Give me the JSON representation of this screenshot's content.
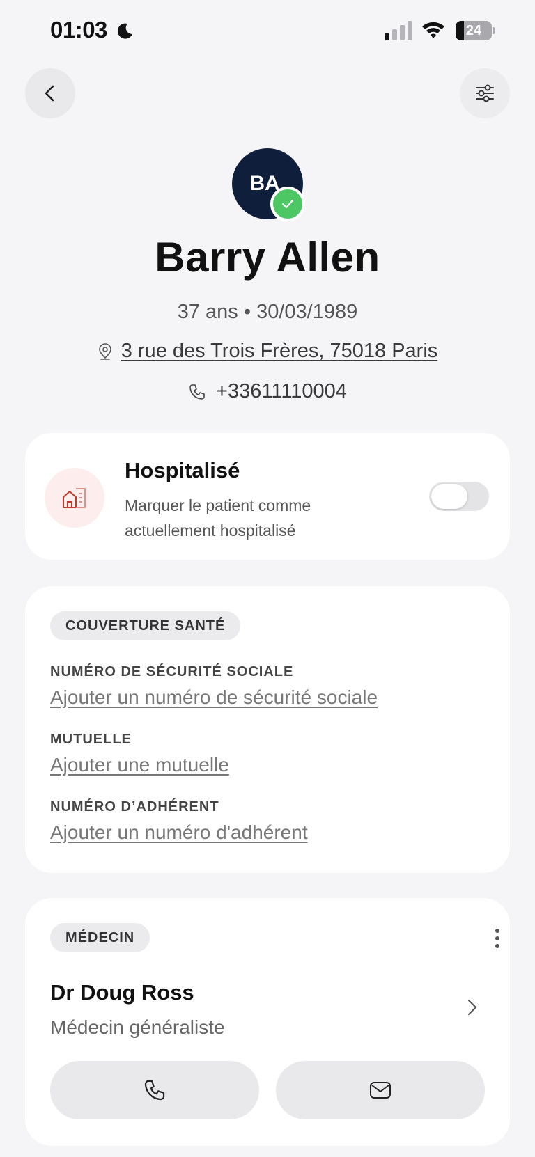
{
  "status_bar": {
    "time": "01:03",
    "battery_level": "24",
    "battery_fraction": 0.24,
    "icons": [
      "moon-icon",
      "cellular-signal-icon",
      "wifi-icon",
      "battery-icon"
    ]
  },
  "nav": {
    "back_icon": "chevron-left-icon",
    "filter_icon": "sliders-icon"
  },
  "patient": {
    "initials": "BA",
    "name": "Barry Allen",
    "age": "37 ans",
    "separator": "•",
    "birthdate": "30/03/1989",
    "address": "3 rue des Trois Frères, 75018 Paris",
    "phone": "+33611110004"
  },
  "hospitalized": {
    "title": "Hospitalisé",
    "description": "Marquer le patient comme actuellement hospitalisé",
    "enabled": false
  },
  "coverage": {
    "badge": "COUVERTURE SANTÉ",
    "fields": [
      {
        "label": "NUMÉRO DE SÉCURITÉ SOCIALE",
        "link": "Ajouter un numéro de sécurité sociale"
      },
      {
        "label": "MUTUELLE",
        "link": "Ajouter une mutuelle"
      },
      {
        "label": "NUMÉRO D’ADHÉRENT",
        "link": "Ajouter un numéro d'adhérent"
      }
    ]
  },
  "doctor": {
    "badge": "MÉDECIN",
    "name": "Dr Doug Ross",
    "specialty": "Médecin généraliste",
    "actions": [
      "phone-icon",
      "mail-icon"
    ]
  },
  "colors": {
    "background": "#f5f5f7",
    "avatar_bg": "#0f1f3b",
    "verified_green": "#4cc764",
    "hospital_accent": "#c0392b"
  }
}
